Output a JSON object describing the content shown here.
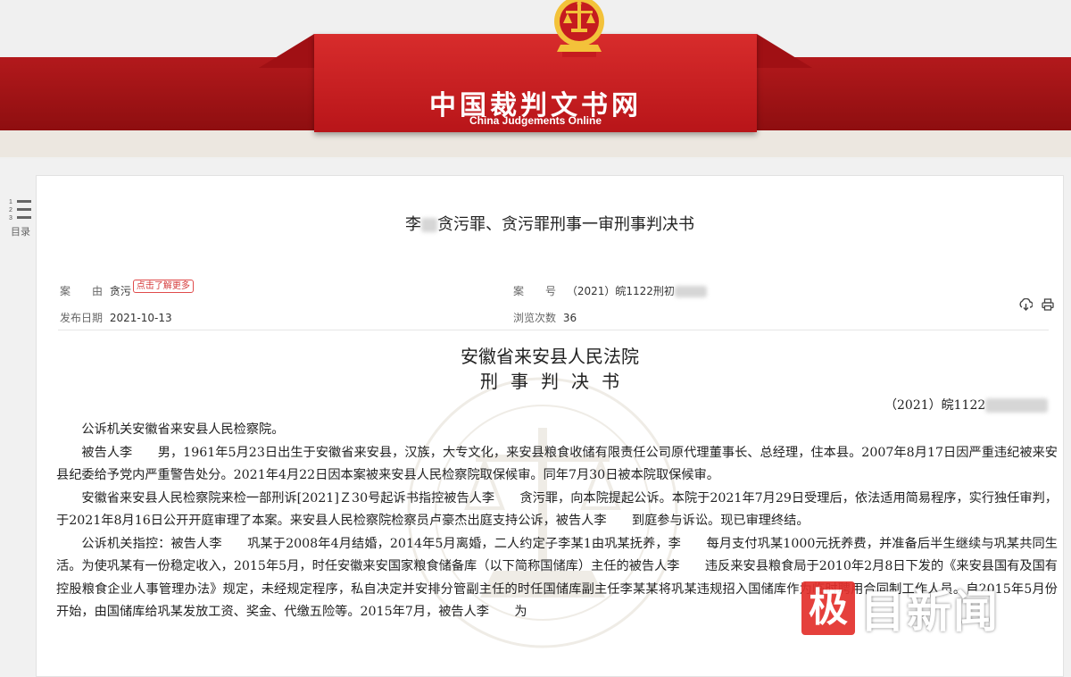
{
  "header": {
    "site_title_cn": "中国裁判文书网",
    "site_title_en": "China Judgements Online",
    "colors": {
      "banner_red": "#b3191c",
      "flag_red": "#d82c2c",
      "gold": "#f3c23a"
    }
  },
  "catalog": {
    "label": "目录",
    "icon": "list-icon"
  },
  "document": {
    "title_prefix": "李",
    "title_suffix": "贪污罪、贪污罪刑事一审刑事判决书",
    "meta": {
      "cause_label": "案　　由",
      "cause_value": "贪污",
      "more_tag": "点击了解更多",
      "case_no_label": "案　　号",
      "case_no_value": "（2021）皖1122刑初",
      "publish_label": "发布日期",
      "publish_value": "2021-10-13",
      "views_label": "浏览次数",
      "views_value": "36"
    },
    "court": "安徽省来安县人民法院",
    "judgement_type": "刑事判决书",
    "case_number": "（2021）皖1122",
    "paragraphs": [
      "公诉机关安徽省来安县人民检察院。",
      "被告人李　　男，1961年5月23日出生于安徽省来安县，汉族，大专文化，来安县粮食收储有限责任公司原代理董事长、总经理，住本县。2007年8月17日因严重违纪被来安县纪委给予党内严重警告处分。2021年4月22日因本案被来安县人民检察院取保候审。同年7月30日被本院取保候审。",
      "安徽省来安县人民检察院来检一部刑诉[2021]Ｚ30号起诉书指控被告人李　　贪污罪，向本院提起公诉。本院于2021年7月29日受理后，依法适用简易程序，实行独任审判，于2021年8月16日公开开庭审理了本案。来安县人民检察院检察员卢豪杰出庭支持公诉，被告人李　　到庭参与诉讼。现已审理终结。",
      "公诉机关指控：被告人李　　巩某于2008年4月结婚，2014年5月离婚，二人约定子李某1由巩某抚养，李　　每月支付巩某1000元抚养费，并准备后半生继续与巩某共同生活。为使巩某有一份稳定收入，2015年5月，时任安徽来安国家粮食储备库（以下简称国储库）主任的被告人李　　违反来安县粮食局于2010年2月8日下发的《来安县国有及国有控股粮食企业人事管理办法》规定，未经规定程序，私自决定并安排分管副主任的时任国储库副主任李某某将巩某违规招入国储库作为临时聘用合同制工作人员。自2015年5月份开始，由国储库给巩某发放工资、奖金、代缴五险等。2015年7月，被告人李　　为"
    ]
  },
  "toolbar": {
    "download_icon": "download-icon",
    "print_icon": "print-icon"
  },
  "watermark": {
    "text": "中华人民共和国最高人民法院"
  },
  "news_logo": {
    "box_char": "极",
    "text": "目新闻"
  }
}
